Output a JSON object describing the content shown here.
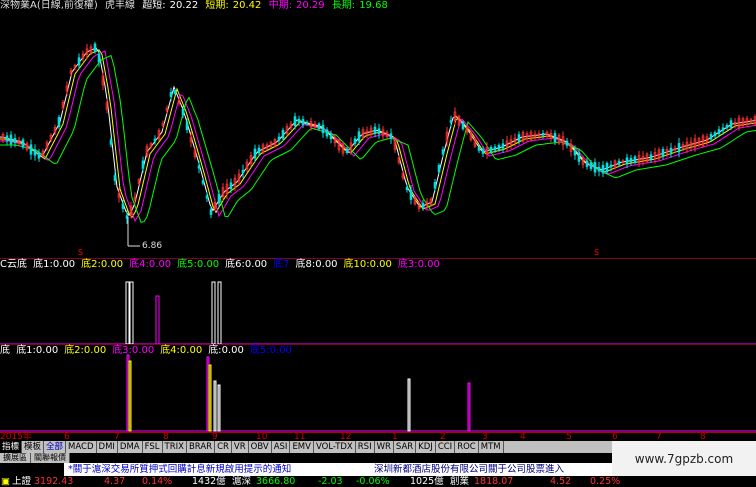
{
  "title_bar": {
    "stock": "深物業A(日線,前復權)",
    "indicator": "虎丰線",
    "short_label": "超短:",
    "short_value": "20.22",
    "shortterm_label": "短期:",
    "shortterm_value": "20.42",
    "mid_label": "中期:",
    "mid_value": "20.29",
    "long_label": "長期:",
    "long_value": "19.68",
    "colors": {
      "short": "#ffffff",
      "shortterm": "#ffff00",
      "mid": "#ff00ff",
      "long": "#00ff00"
    }
  },
  "main_chart": {
    "low_marker": "6.86",
    "signal_marks": [
      "S",
      "S"
    ]
  },
  "indicator1": {
    "name": "C云底",
    "items": [
      {
        "label": "底1:",
        "value": "0.00",
        "color": "#ffffff"
      },
      {
        "label": "底2:",
        "value": "0.00",
        "color": "#ffff00"
      },
      {
        "label": "底4:",
        "value": "0.00",
        "color": "#ff00ff"
      },
      {
        "label": "底5:",
        "value": "0.00",
        "color": "#00ff00"
      },
      {
        "label": "底6:",
        "value": "0.00",
        "color": "#ffffff"
      },
      {
        "label": "底7",
        "value": "",
        "color": "#0000ff"
      },
      {
        "label": "底8:",
        "value": "0.00",
        "color": "#ffffff"
      },
      {
        "label": "底10:",
        "value": "0.00",
        "color": "#ffff00"
      },
      {
        "label": "底3:",
        "value": "0.00",
        "color": "#ff00ff"
      }
    ]
  },
  "indicator2": {
    "name": "底",
    "items": [
      {
        "label": "底1:",
        "value": "0.00",
        "color": "#ffffff"
      },
      {
        "label": "底2:",
        "value": "0.00",
        "color": "#ffff00"
      },
      {
        "label": "底3:",
        "value": "0.00",
        "color": "#ff00ff"
      },
      {
        "label": "底4:",
        "value": "0.00",
        "color": "#ffff00"
      },
      {
        "label": "底:",
        "value": "0.00",
        "color": "#ffffff"
      },
      {
        "label": "底5:",
        "value": "0.00",
        "color": "#0000ff"
      }
    ]
  },
  "time_axis": [
    "2015年",
    "6",
    "7",
    "8",
    "9",
    "10",
    "11",
    "12",
    "1",
    "2",
    "3",
    "4",
    "5",
    "6",
    "7",
    "8"
  ],
  "tabs": [
    "指標",
    "模板",
    "全部",
    "MACD",
    "DMI",
    "DMA",
    "FSL",
    "TRIX",
    "BRAR",
    "CR",
    "VR",
    "OBV",
    "ASI",
    "EMV",
    "VOL-TDX",
    "RSI",
    "WR",
    "SAR",
    "KDJ",
    "CCI",
    "ROC",
    "MTM"
  ],
  "sub_tabs": [
    "擴展區",
    "關聯報價"
  ],
  "news": {
    "item1": "*關于滬深交易所質押式回購計息新規啟用提示的通知",
    "item2": "深圳新都酒店股份有限公司關于公司股票進入"
  },
  "watermark": "www.7gpzb.com",
  "status_bar": {
    "sh_label": "上證",
    "sh_value": "3192.43",
    "sh_change": "4.37",
    "sh_pct": "0.14%",
    "sh_volume": "1432億",
    "sz_label": "滬深",
    "sz_value": "3666.80",
    "sz_change": "-2.03",
    "sz_pct": "-0.06%",
    "sz_volume": "1025億",
    "cy_label": "創業",
    "cy_value": "1818.07",
    "cy_change": "4.52",
    "cy_pct": "0.25%"
  }
}
